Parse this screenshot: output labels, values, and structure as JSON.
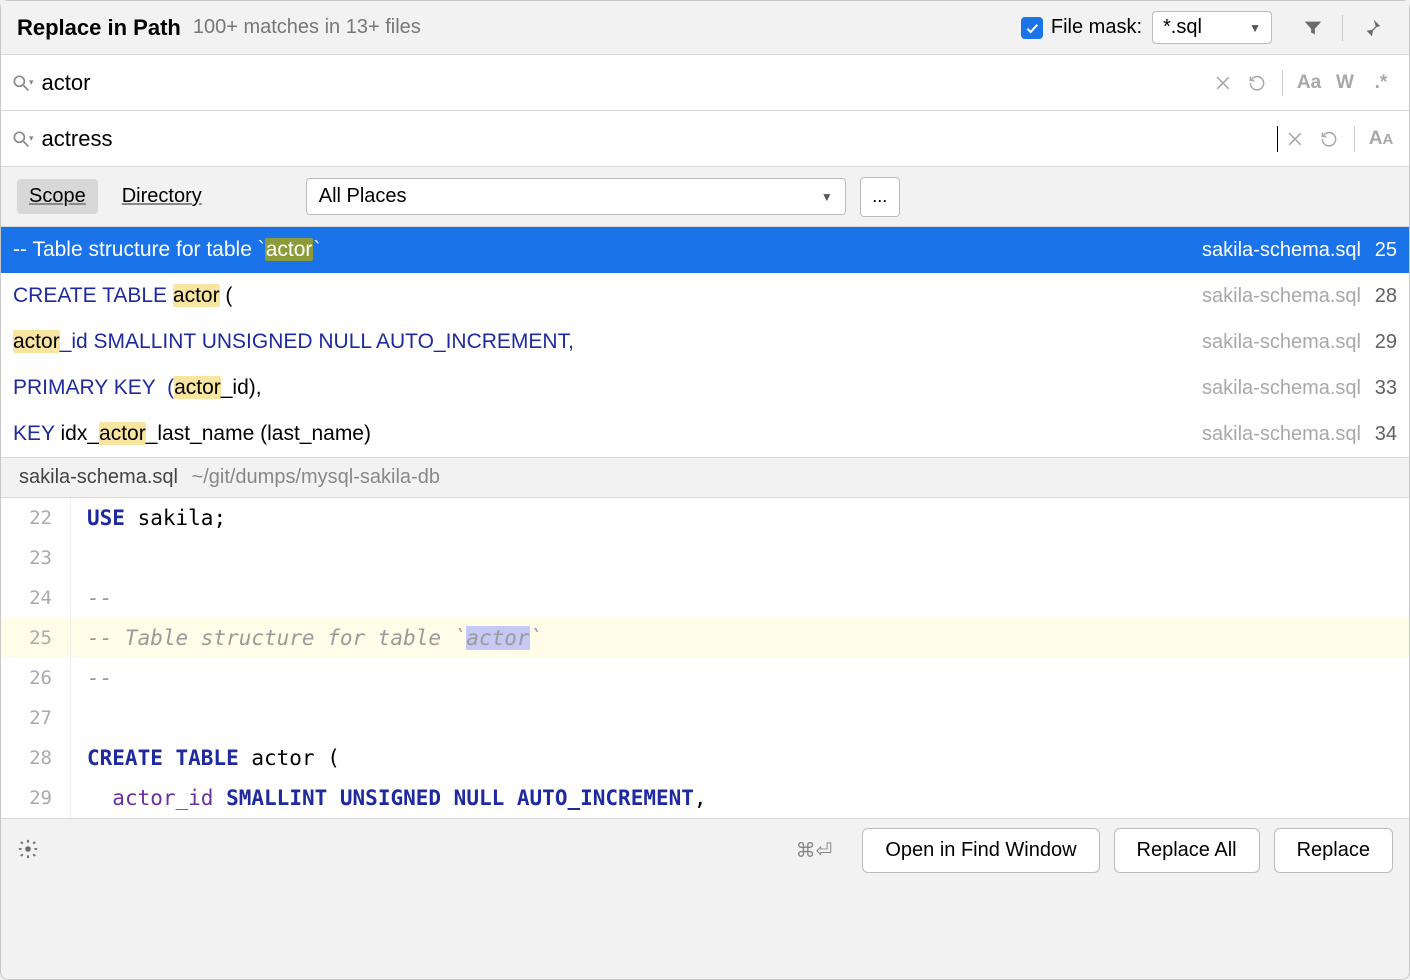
{
  "header": {
    "title": "Replace in Path",
    "subtitle": "100+ matches in 13+ files",
    "file_mask_label": "File mask:",
    "file_mask_value": "*.sql"
  },
  "search": {
    "value": "actor"
  },
  "replace": {
    "value": "actress"
  },
  "toggles": {
    "match_case": "Aa",
    "words": "W",
    "regex": ".*",
    "preserve_case": "AA"
  },
  "scope": {
    "tab_scope": "Scope",
    "tab_directory": "Directory",
    "dropdown": "All Places",
    "ellipsis": "..."
  },
  "results": [
    {
      "prefix": "-- Table structure for table `",
      "match": "actor",
      "suffix": "`",
      "file": "sakila-schema.sql",
      "line": "25",
      "selected": true,
      "comment": true
    },
    {
      "prefix": "CREATE TABLE ",
      "match": "actor",
      "suffix": " (",
      "file": "sakila-schema.sql",
      "line": "28",
      "selected": false,
      "kw_prefix": true
    },
    {
      "prefix": "",
      "match": "actor",
      "suffix": "_id SMALLINT UNSIGNED NULL AUTO_INCREMENT,",
      "file": "sakila-schema.sql",
      "line": "29",
      "selected": false,
      "kw_suffix": true
    },
    {
      "prefix": "PRIMARY KEY  (",
      "match": "actor",
      "suffix": "_id),",
      "file": "sakila-schema.sql",
      "line": "33",
      "selected": false,
      "kw_prefix": true
    },
    {
      "prefix": "KEY idx_",
      "match": "actor",
      "suffix": "_last_name (last_name)",
      "file": "sakila-schema.sql",
      "line": "34",
      "selected": false,
      "mixed": true
    }
  ],
  "preview": {
    "filename": "sakila-schema.sql",
    "path": "~/git/dumps/mysql-sakila-db",
    "lines": [
      {
        "n": "22",
        "html": "<span class='ekw'>USE</span> sakila;"
      },
      {
        "n": "23",
        "html": ""
      },
      {
        "n": "24",
        "html": "<span class='cmt'>--</span>"
      },
      {
        "n": "25",
        "html": "<span class='cmt'>-- Table structure for table `<span class='sel-hl'>actor</span>`</span>",
        "current": true
      },
      {
        "n": "26",
        "html": "<span class='cmt'>--</span>"
      },
      {
        "n": "27",
        "html": ""
      },
      {
        "n": "28",
        "html": "<span class='ekw'>CREATE TABLE</span> actor ("
      },
      {
        "n": "29",
        "html": "  <span class='id2'>actor_id</span> <span class='ekw'>SMALLINT UNSIGNED NULL AUTO_INCREMENT</span>,"
      }
    ]
  },
  "footer": {
    "shortcut": "⌘⏎",
    "open": "Open in Find Window",
    "replace_all": "Replace All",
    "replace": "Replace"
  }
}
